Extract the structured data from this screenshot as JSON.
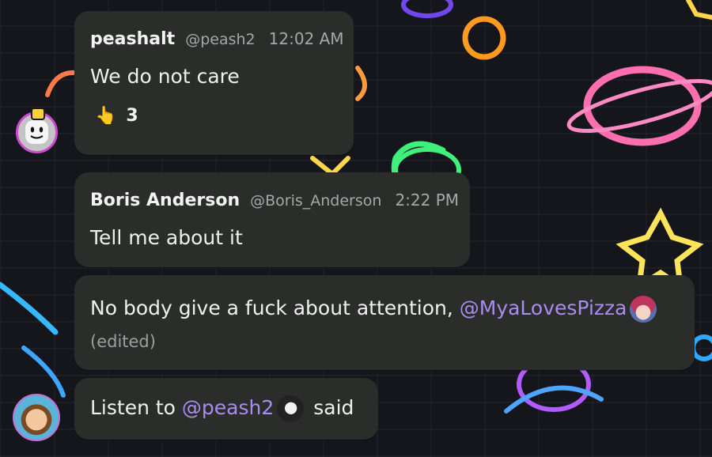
{
  "messages": [
    {
      "author": "peashalt",
      "handle": "@peash2",
      "time": "12:02 AM",
      "text": "We do not care",
      "reaction": {
        "emoji": "👆",
        "count": "3"
      }
    },
    {
      "author": "Boris Anderson",
      "handle": "@Boris_Anderson",
      "time": "2:22 PM",
      "text": "Tell me about it"
    },
    {
      "text_prefix": "No body give a fuck about attention, ",
      "mention": "@MyaLovesPizza",
      "edited": "(edited)"
    },
    {
      "text_prefix": "Listen to ",
      "mention": "@peash2",
      "text_suffix": " said"
    }
  ],
  "colors": {
    "bubble": "#2b2d2b",
    "mention": "#a98cf0",
    "meta": "#a6a7a8"
  }
}
